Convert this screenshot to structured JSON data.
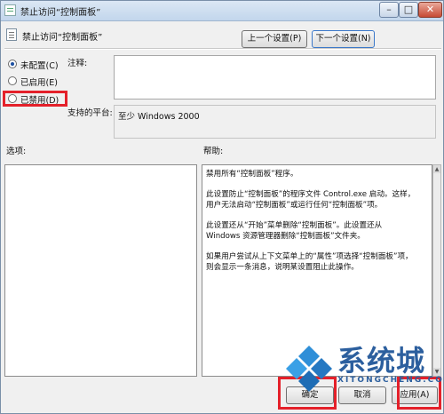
{
  "window": {
    "title": "禁止访问“控制面板”",
    "controls": {
      "minimize": "–",
      "maximize": "□",
      "close": "✕"
    }
  },
  "header": {
    "title": "禁止访问“控制面板”",
    "prev_button": "上一个设置(P)",
    "next_button": "下一个设置(N)"
  },
  "state": {
    "options": [
      {
        "label": "未配置(C)",
        "selected": true
      },
      {
        "label": "已启用(E)",
        "selected": false
      },
      {
        "label": "已禁用(D)",
        "selected": false
      }
    ]
  },
  "comment": {
    "label": "注释:",
    "value": ""
  },
  "platform": {
    "label": "支持的平台:",
    "value": "至少 Windows 2000"
  },
  "options_pane": {
    "label": "选项:"
  },
  "help_pane": {
    "label": "帮助:",
    "paragraphs": [
      "禁用所有“控制面板”程序。",
      "此设置防止“控制面板”的程序文件 Control.exe 启动。这样，\n用户无法启动“控制面板”或运行任何“控制面板”项。",
      "此设置还从“开始”菜单删除“控制面板”。此设置还从\nWindows 资源管理器删除“控制面板”文件夹。",
      "如果用户尝试从上下文菜单上的“属性”项选择“控制面板”项，\n则会显示一条消息，说明某设置阻止此操作。"
    ]
  },
  "footer": {
    "ok_button": "确定",
    "cancel_button": "取消",
    "apply_button": "应用(A)"
  },
  "watermark": {
    "text": "系统城",
    "sub": "XITONGCHENG.COM"
  },
  "colors": {
    "highlight": "#e4202a",
    "selection_dot": "#1c4fa0",
    "watermark": "#2c5f9e"
  }
}
